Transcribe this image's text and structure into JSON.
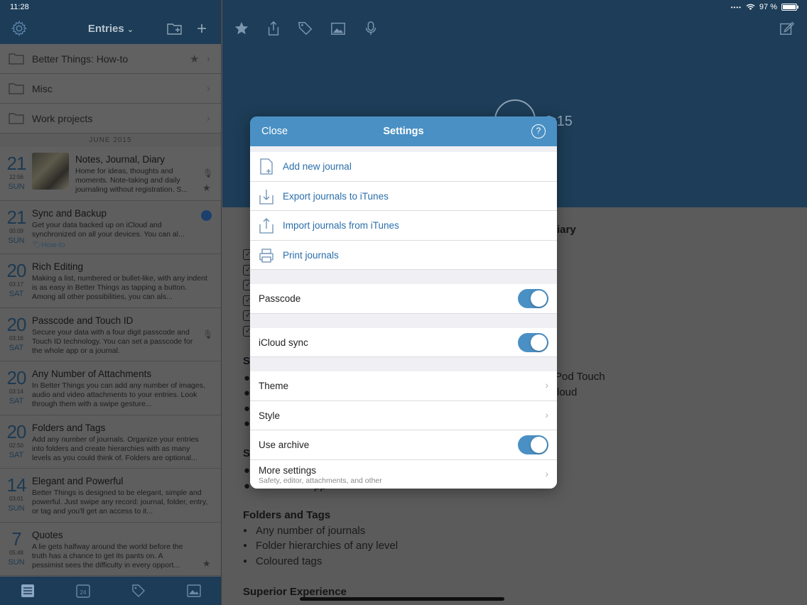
{
  "status": {
    "time": "11:28",
    "battery": "97 %"
  },
  "sidebar": {
    "title": "Entries",
    "folders": [
      {
        "label": "Better Things: How-to",
        "starred": true
      },
      {
        "label": "Misc"
      },
      {
        "label": "Work projects"
      }
    ],
    "section": "JUNE 2015",
    "entries": [
      {
        "day": "21",
        "time": "12:56",
        "dow": "SUN",
        "title": "Notes, Journal, Diary",
        "body": "Home for ideas, thoughts and moments. Note-taking and daily journaling without registration. S..."
      },
      {
        "day": "21",
        "time": "00:09",
        "dow": "SUN",
        "title": "Sync and Backup",
        "body": "Get your data backed up on iCloud and synchronized on all your devices. You can al...",
        "tag": "How-to"
      },
      {
        "day": "20",
        "time": "03:17",
        "dow": "SAT",
        "title": "Rich Editing",
        "body": "Making a list, numbered or bullet-like, with any indent is as easy in Better Things as tapping a button. Among all other possibilities, you can als..."
      },
      {
        "day": "20",
        "time": "03:16",
        "dow": "SAT",
        "title": "Passcode and Touch ID",
        "body": "Secure your data with a four digit passcode and Touch ID technology. You can set a passcode for the whole app or a journal."
      },
      {
        "day": "20",
        "time": "03:14",
        "dow": "SAT",
        "title": "Any Number of Attachments",
        "body": "In Better Things you can add any number of images, audio and video attachments to your entries. Look through them with a swipe gesture..."
      },
      {
        "day": "20",
        "time": "02:50",
        "dow": "SAT",
        "title": "Folders and Tags",
        "body": "Add any number of journals. Organize your entries into folders and create hierarchies with as many levels as you could think of. Folders are optional..."
      },
      {
        "day": "14",
        "time": "03:01",
        "dow": "SUN",
        "title": "Elegant and Powerful",
        "body": "Better Things is designed to be elegant, simple and powerful. Just swipe any record: journal, folder, entry, or tag and you'll get an access to it..."
      },
      {
        "day": "7",
        "time": "05:48",
        "dow": "SUN",
        "title": "Quotes",
        "body": "A lie gets halfway around the world before the truth has a chance to get its pants on.  A pessimist sees the difficulty in every opport..."
      }
    ],
    "bottom_date": "24"
  },
  "main": {
    "rec_time": "0:15",
    "doc": {
      "frag_iary": "iary",
      "frag_sy": "Sy",
      "frag_pod": "Pod Touch",
      "frag_loud": "loud",
      "frag_se": "Se",
      "frag_pp": "pp",
      "h_folders": "Folders and Tags",
      "b1": "Any number of journals",
      "b2": "Folder hierarchies of any level",
      "b3": "Coloured tags",
      "h_superior": "Superior Experience"
    }
  },
  "settings": {
    "close": "Close",
    "title": "Settings",
    "help": "?",
    "actions": [
      "Add new journal",
      "Export journals to iTunes",
      "Import journals from iTunes",
      "Print journals"
    ],
    "passcode": "Passcode",
    "icloud": "iCloud sync",
    "theme": "Theme",
    "style": "Style",
    "archive": "Use archive",
    "more": "More settings",
    "more_sub": "Safety, editor, attachments, and other"
  },
  "colors": {
    "accent": "#4a90c4",
    "navbar": "#1d3d58"
  }
}
